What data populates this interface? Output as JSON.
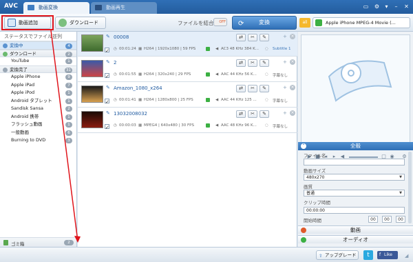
{
  "app": {
    "name": "AVC"
  },
  "tabs": [
    {
      "label": "動画変換",
      "active": true
    },
    {
      "label": "動画再生",
      "active": false
    }
  ],
  "toolbar": {
    "add_video": "動画追加",
    "download": "ダウンロード",
    "merge_label": "ファイルを結合",
    "merge_toggle": "OFF",
    "convert": "変換",
    "all_badge": "all",
    "profile": "Apple iPhone MPEG-4 Movie (..."
  },
  "sidebar": {
    "header": "ステータスでファイル並列",
    "items": [
      {
        "label": "変換中",
        "count": "4",
        "type": "section",
        "selected": true
      },
      {
        "label": "ダウンロード",
        "count": "2",
        "type": "section",
        "selected": false
      },
      {
        "label": "YouTube",
        "count": "1",
        "type": "item",
        "selected": false
      },
      {
        "label": "変換完了",
        "count": "31",
        "type": "section",
        "selected": false
      },
      {
        "label": "Apple iPhone",
        "count": "9",
        "type": "item",
        "selected": false
      },
      {
        "label": "Apple iPad",
        "count": "7",
        "type": "item",
        "selected": false
      },
      {
        "label": "Apple iPod",
        "count": "1",
        "type": "item",
        "selected": false
      },
      {
        "label": "Android タブレット",
        "count": "1",
        "type": "item",
        "selected": false
      },
      {
        "label": "Sandisk Sansa",
        "count": "2",
        "type": "item",
        "selected": false
      },
      {
        "label": "Android 携帯",
        "count": "1",
        "type": "item",
        "selected": false
      },
      {
        "label": "フラッシュ動画",
        "count": "1",
        "type": "item",
        "selected": false
      },
      {
        "label": "一般動画",
        "count": "6",
        "type": "item",
        "selected": false
      },
      {
        "label": "Burning to DVD",
        "count": "3",
        "type": "item",
        "selected": false
      }
    ],
    "trash": {
      "label": "ゴミ箱",
      "count": "2"
    }
  },
  "files": [
    {
      "name": "00008",
      "duration": "00:01:24",
      "video": "H264 | 1920x1080 | 59 FPS",
      "audio": "AC3 48 KHz 384 K...",
      "subtitle": "Subtitle 1",
      "selected": true
    },
    {
      "name": "2",
      "duration": "00:01:55",
      "video": "H264 | 320x240 | 29 FPS",
      "audio": "AAC 44 KHz 56 K...",
      "subtitle": "字幕なし",
      "selected": false
    },
    {
      "name": "Amazon_1080_x264",
      "duration": "00:01:41",
      "video": "H264 | 1280x800 | 25 FPS",
      "audio": "AAC 44 KHz 125 ...",
      "subtitle": "字幕なし",
      "selected": false
    },
    {
      "name": "13032008032",
      "duration": "00:00:03",
      "video": "MPEG4 | 640x480 | 30 FPS",
      "audio": "AAC 48 KHz 96 K...",
      "subtitle": "字幕なし",
      "selected": false
    }
  ],
  "settings": {
    "title": "全般",
    "filename_label": "ファイル名",
    "filename_value": "",
    "size_label": "動画サイズ",
    "size_value": "480x270",
    "quality_label": "画質",
    "quality_value": "普通",
    "clip_label": "クリップ時間",
    "clip_value": "00:00:00",
    "start_label": "開始時間",
    "start_h": "00",
    "start_m": "00",
    "start_s": "00",
    "video_section": "動画",
    "audio_section": "オーディオ"
  },
  "statusbar": {
    "upgrade": "アップグレード",
    "twitter": "t",
    "facebook": "Like"
  }
}
